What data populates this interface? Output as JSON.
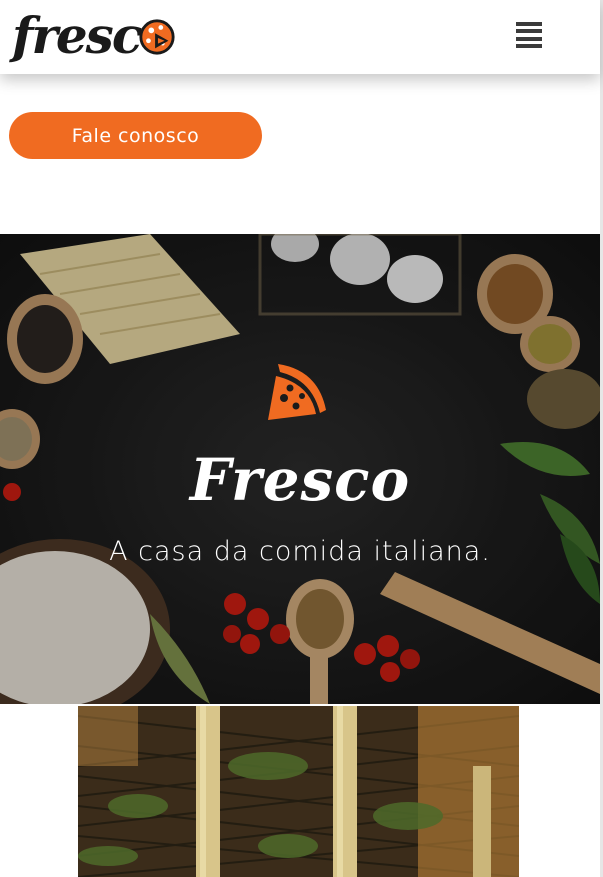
{
  "header": {
    "logo_text": "fresc",
    "logo_icon": "pizza-icon",
    "menu_icon": "hamburger-menu-icon"
  },
  "cta": {
    "label": "Fale conosco"
  },
  "hero": {
    "icon": "pizza-slice-icon",
    "title": "Fresco",
    "subtitle": "A casa da comida italiana."
  },
  "colors": {
    "accent": "#f06b21",
    "dark": "#1b1b1b",
    "text_light": "#ffffff"
  }
}
